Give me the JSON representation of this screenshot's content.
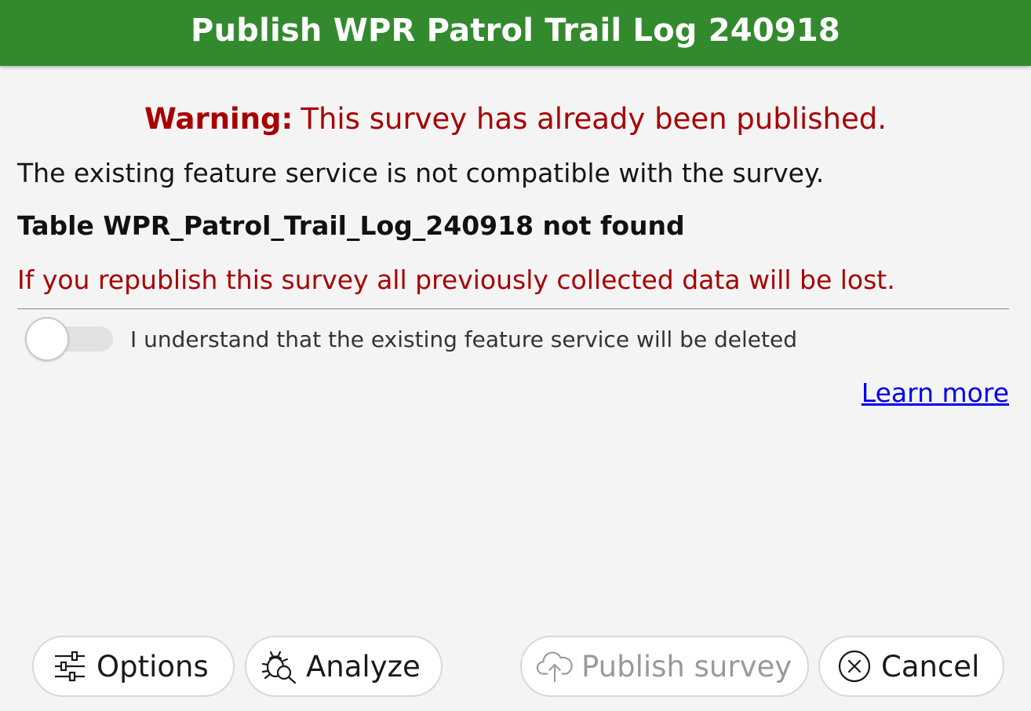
{
  "titlebar": {
    "title": "Publish WPR Patrol Trail Log 240918",
    "color": "#338a2e"
  },
  "warning": {
    "label": "Warning:",
    "text": "This survey has already been published.",
    "color": "#a80000"
  },
  "messages": {
    "incompatible": "The existing feature service is not compatible with the survey.",
    "table_not_found": "Table WPR_Patrol_Trail_Log_240918 not found",
    "data_loss": "If you republish this survey all previously collected data will be lost."
  },
  "confirm_toggle": {
    "label": "I understand that the existing feature service will be deleted",
    "checked": false
  },
  "learn_more": {
    "label": "Learn more"
  },
  "buttons": {
    "options": {
      "label": "Options",
      "icon": "sliders-icon"
    },
    "analyze": {
      "label": "Analyze",
      "icon": "bug-search-icon"
    },
    "publish": {
      "label": "Publish survey",
      "icon": "cloud-upload-icon",
      "disabled": true
    },
    "cancel": {
      "label": "Cancel",
      "icon": "close-circle-icon"
    }
  }
}
